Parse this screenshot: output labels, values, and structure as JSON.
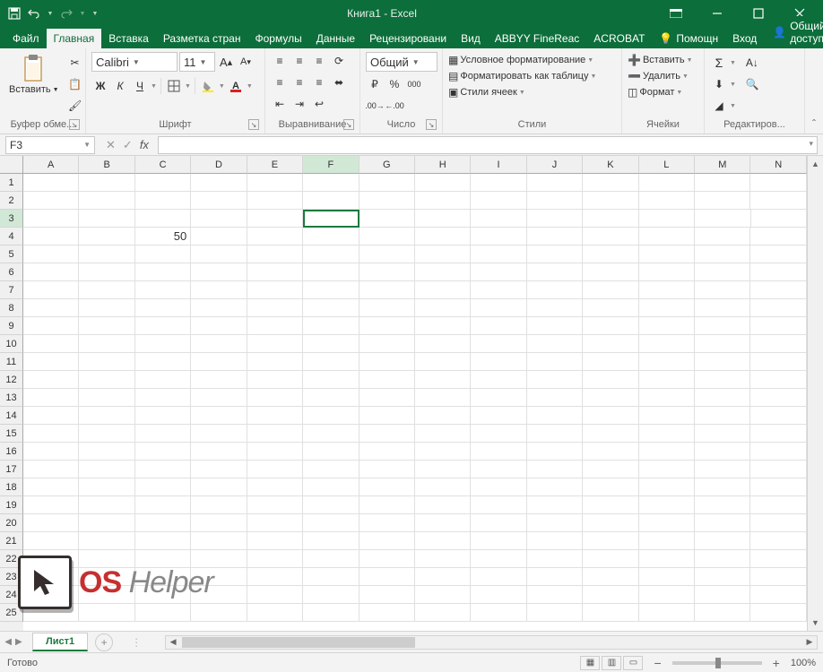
{
  "title": "Книга1 - Excel",
  "tabs": {
    "file": "Файл",
    "items": [
      "Главная",
      "Вставка",
      "Разметка стран",
      "Формулы",
      "Данные",
      "Рецензировани",
      "Вид",
      "ABBYY FineReac",
      "ACROBAT"
    ],
    "tell_me": "Помощн",
    "signin": "Вход",
    "share": "Общий доступ"
  },
  "ribbon": {
    "clipboard": {
      "paste": "Вставить",
      "label": "Буфер обме..."
    },
    "font": {
      "name": "Calibri",
      "size": "11",
      "label": "Шрифт",
      "bold": "Ж",
      "italic": "К",
      "underline": "Ч"
    },
    "align": {
      "label": "Выравнивание"
    },
    "number": {
      "format": "Общий",
      "label": "Число"
    },
    "styles": {
      "cond": "Условное форматирование",
      "table": "Форматировать как таблицу",
      "cell": "Стили ячеек",
      "label": "Стили"
    },
    "cells": {
      "insert": "Вставить",
      "delete": "Удалить",
      "format": "Формат",
      "label": "Ячейки"
    },
    "editing": {
      "label": "Редактиров..."
    }
  },
  "namebox": "F3",
  "columns": [
    "A",
    "B",
    "C",
    "D",
    "E",
    "F",
    "G",
    "H",
    "I",
    "J",
    "K",
    "L",
    "M",
    "N"
  ],
  "rows": 25,
  "selected": {
    "row": 3,
    "col": "F"
  },
  "cellData": {
    "C4": "50"
  },
  "sheet_tab": "Лист1",
  "status": "Готово",
  "zoom": "100%",
  "watermark": {
    "os": "OS",
    "helper": " Helper"
  }
}
